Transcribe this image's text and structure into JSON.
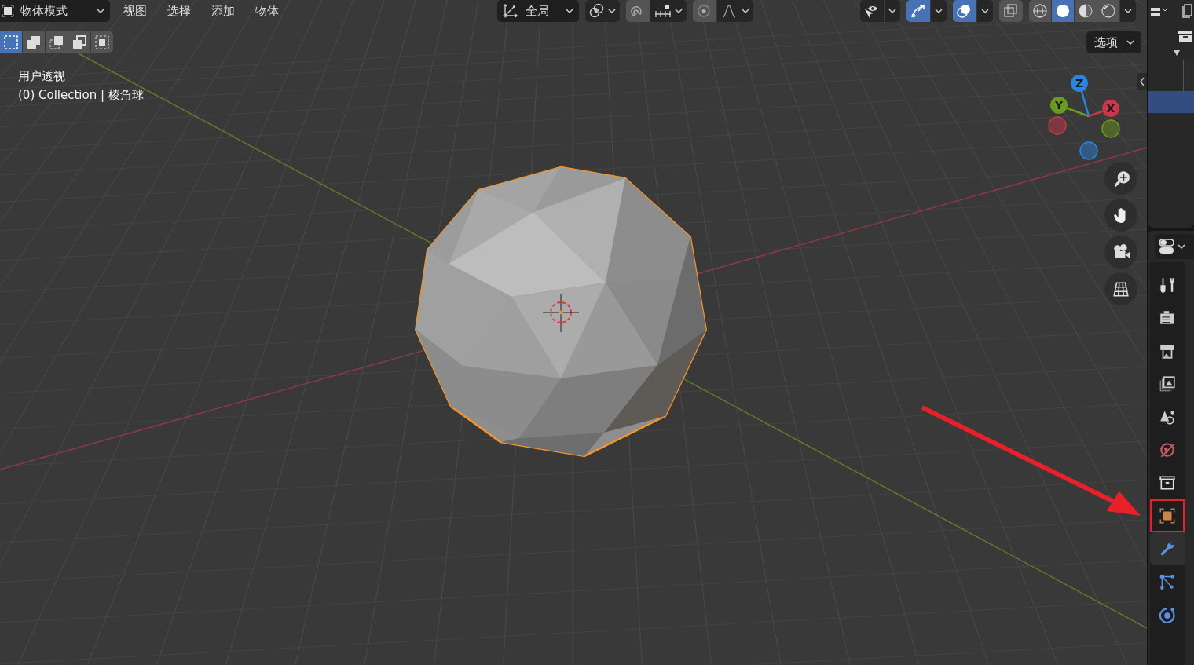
{
  "header": {
    "mode": "物体模式",
    "menus": [
      "视图",
      "选择",
      "添加",
      "物体"
    ],
    "orientation": "全局",
    "options": "选项"
  },
  "select_modes": [
    {
      "kind": "new",
      "selected": true
    },
    {
      "kind": "extend",
      "selected": false
    },
    {
      "kind": "subtract",
      "selected": false
    },
    {
      "kind": "invert",
      "selected": false
    },
    {
      "kind": "intersect",
      "selected": false
    }
  ],
  "header_toggles": [
    {
      "kind": "snap",
      "on": false
    },
    {
      "kind": "proportional",
      "on": false
    },
    {
      "kind": "visibility",
      "on": false
    },
    {
      "kind": "gizmo",
      "on": true
    },
    {
      "kind": "overlay",
      "on": true
    },
    {
      "kind": "xray",
      "on": false
    }
  ],
  "shading_modes": [
    {
      "kind": "wireframe",
      "selected": false
    },
    {
      "kind": "solid",
      "selected": true
    },
    {
      "kind": "material",
      "selected": false
    },
    {
      "kind": "rendered",
      "selected": false
    }
  ],
  "viewport_info": {
    "view": "用户透视",
    "collection": "(0) Collection | 棱角球"
  },
  "gizmo": {
    "axes": [
      {
        "label": "Z",
        "color": "#2b84e0"
      },
      {
        "label": "Y",
        "color": "#6a9a1f"
      },
      {
        "label": "X",
        "color": "#c9374c"
      }
    ]
  },
  "navigation_buttons": [
    {
      "kind": "zoom"
    },
    {
      "kind": "pan"
    },
    {
      "kind": "camera"
    },
    {
      "kind": "ortho"
    }
  ],
  "properties_tabs": [
    {
      "kind": "tool",
      "selected": false,
      "highlighted": false
    },
    {
      "kind": "render",
      "selected": false,
      "highlighted": false
    },
    {
      "kind": "output",
      "selected": false,
      "highlighted": false
    },
    {
      "kind": "view_layer",
      "selected": false,
      "highlighted": false
    },
    {
      "kind": "scene",
      "selected": false,
      "highlighted": false
    },
    {
      "kind": "world",
      "selected": false,
      "highlighted": false
    },
    {
      "kind": "collection",
      "selected": false,
      "highlighted": false
    },
    {
      "kind": "object",
      "selected": false,
      "highlighted": true
    },
    {
      "kind": "modifier",
      "selected": true,
      "highlighted": false
    },
    {
      "kind": "particles",
      "selected": false,
      "highlighted": false
    },
    {
      "kind": "physics",
      "selected": false,
      "highlighted": false
    }
  ]
}
